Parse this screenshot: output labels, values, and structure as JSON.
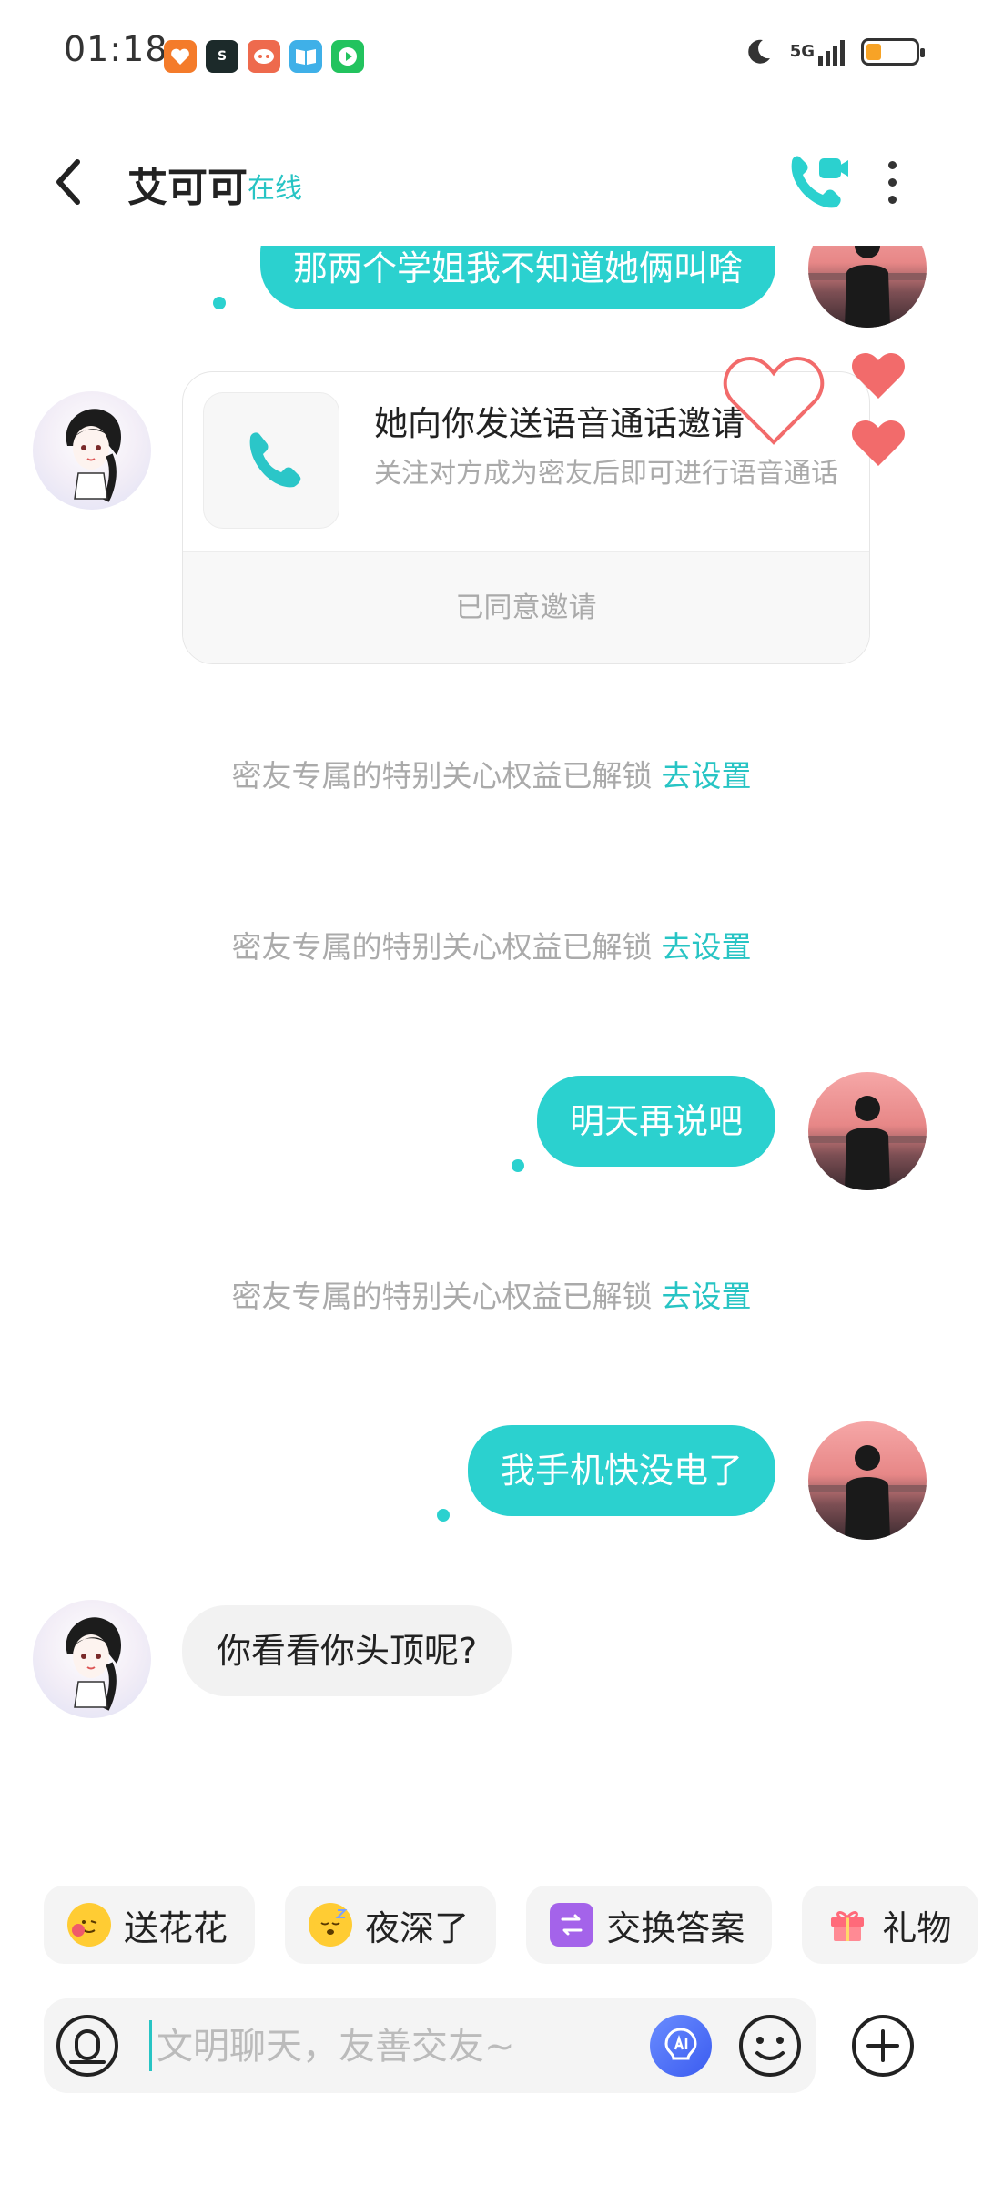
{
  "status_bar": {
    "time": "01:18",
    "network": "5G",
    "app_icons": [
      "taobao-icon",
      "soul-icon",
      "chat-app-icon",
      "reader-icon",
      "video-icon"
    ]
  },
  "header": {
    "name": "艾可可",
    "status": "在线"
  },
  "messages": {
    "m1": "那两个学姐我不知道她俩叫啥",
    "call_card": {
      "title": "她向你发送语音通话邀请",
      "desc": "关注对方成为密友后即可进行语音通话",
      "footer": "已同意邀请"
    },
    "sys1": {
      "text": "密友专属的特别关心权益已解锁",
      "link": "去设置"
    },
    "sys2": {
      "text": "密友专属的特别关心权益已解锁",
      "link": "去设置"
    },
    "m2": "明天再说吧",
    "sys3": {
      "text": "密友专属的特别关心权益已解锁",
      "link": "去设置"
    },
    "m3": "我手机快没电了",
    "m4": "你看看你头顶呢?"
  },
  "chips": [
    {
      "label": "送花花",
      "icon": "flower-emoji-icon"
    },
    {
      "label": "夜深了",
      "icon": "sleepy-emoji-icon"
    },
    {
      "label": "交换答案",
      "icon": "exchange-icon"
    },
    {
      "label": "礼物",
      "icon": "gift-icon"
    }
  ],
  "input": {
    "placeholder": "文明聊天，友善交友~"
  },
  "colors": {
    "accent": "#2bd1cf",
    "link": "#27c4c4",
    "heart": "#f26b6b"
  }
}
